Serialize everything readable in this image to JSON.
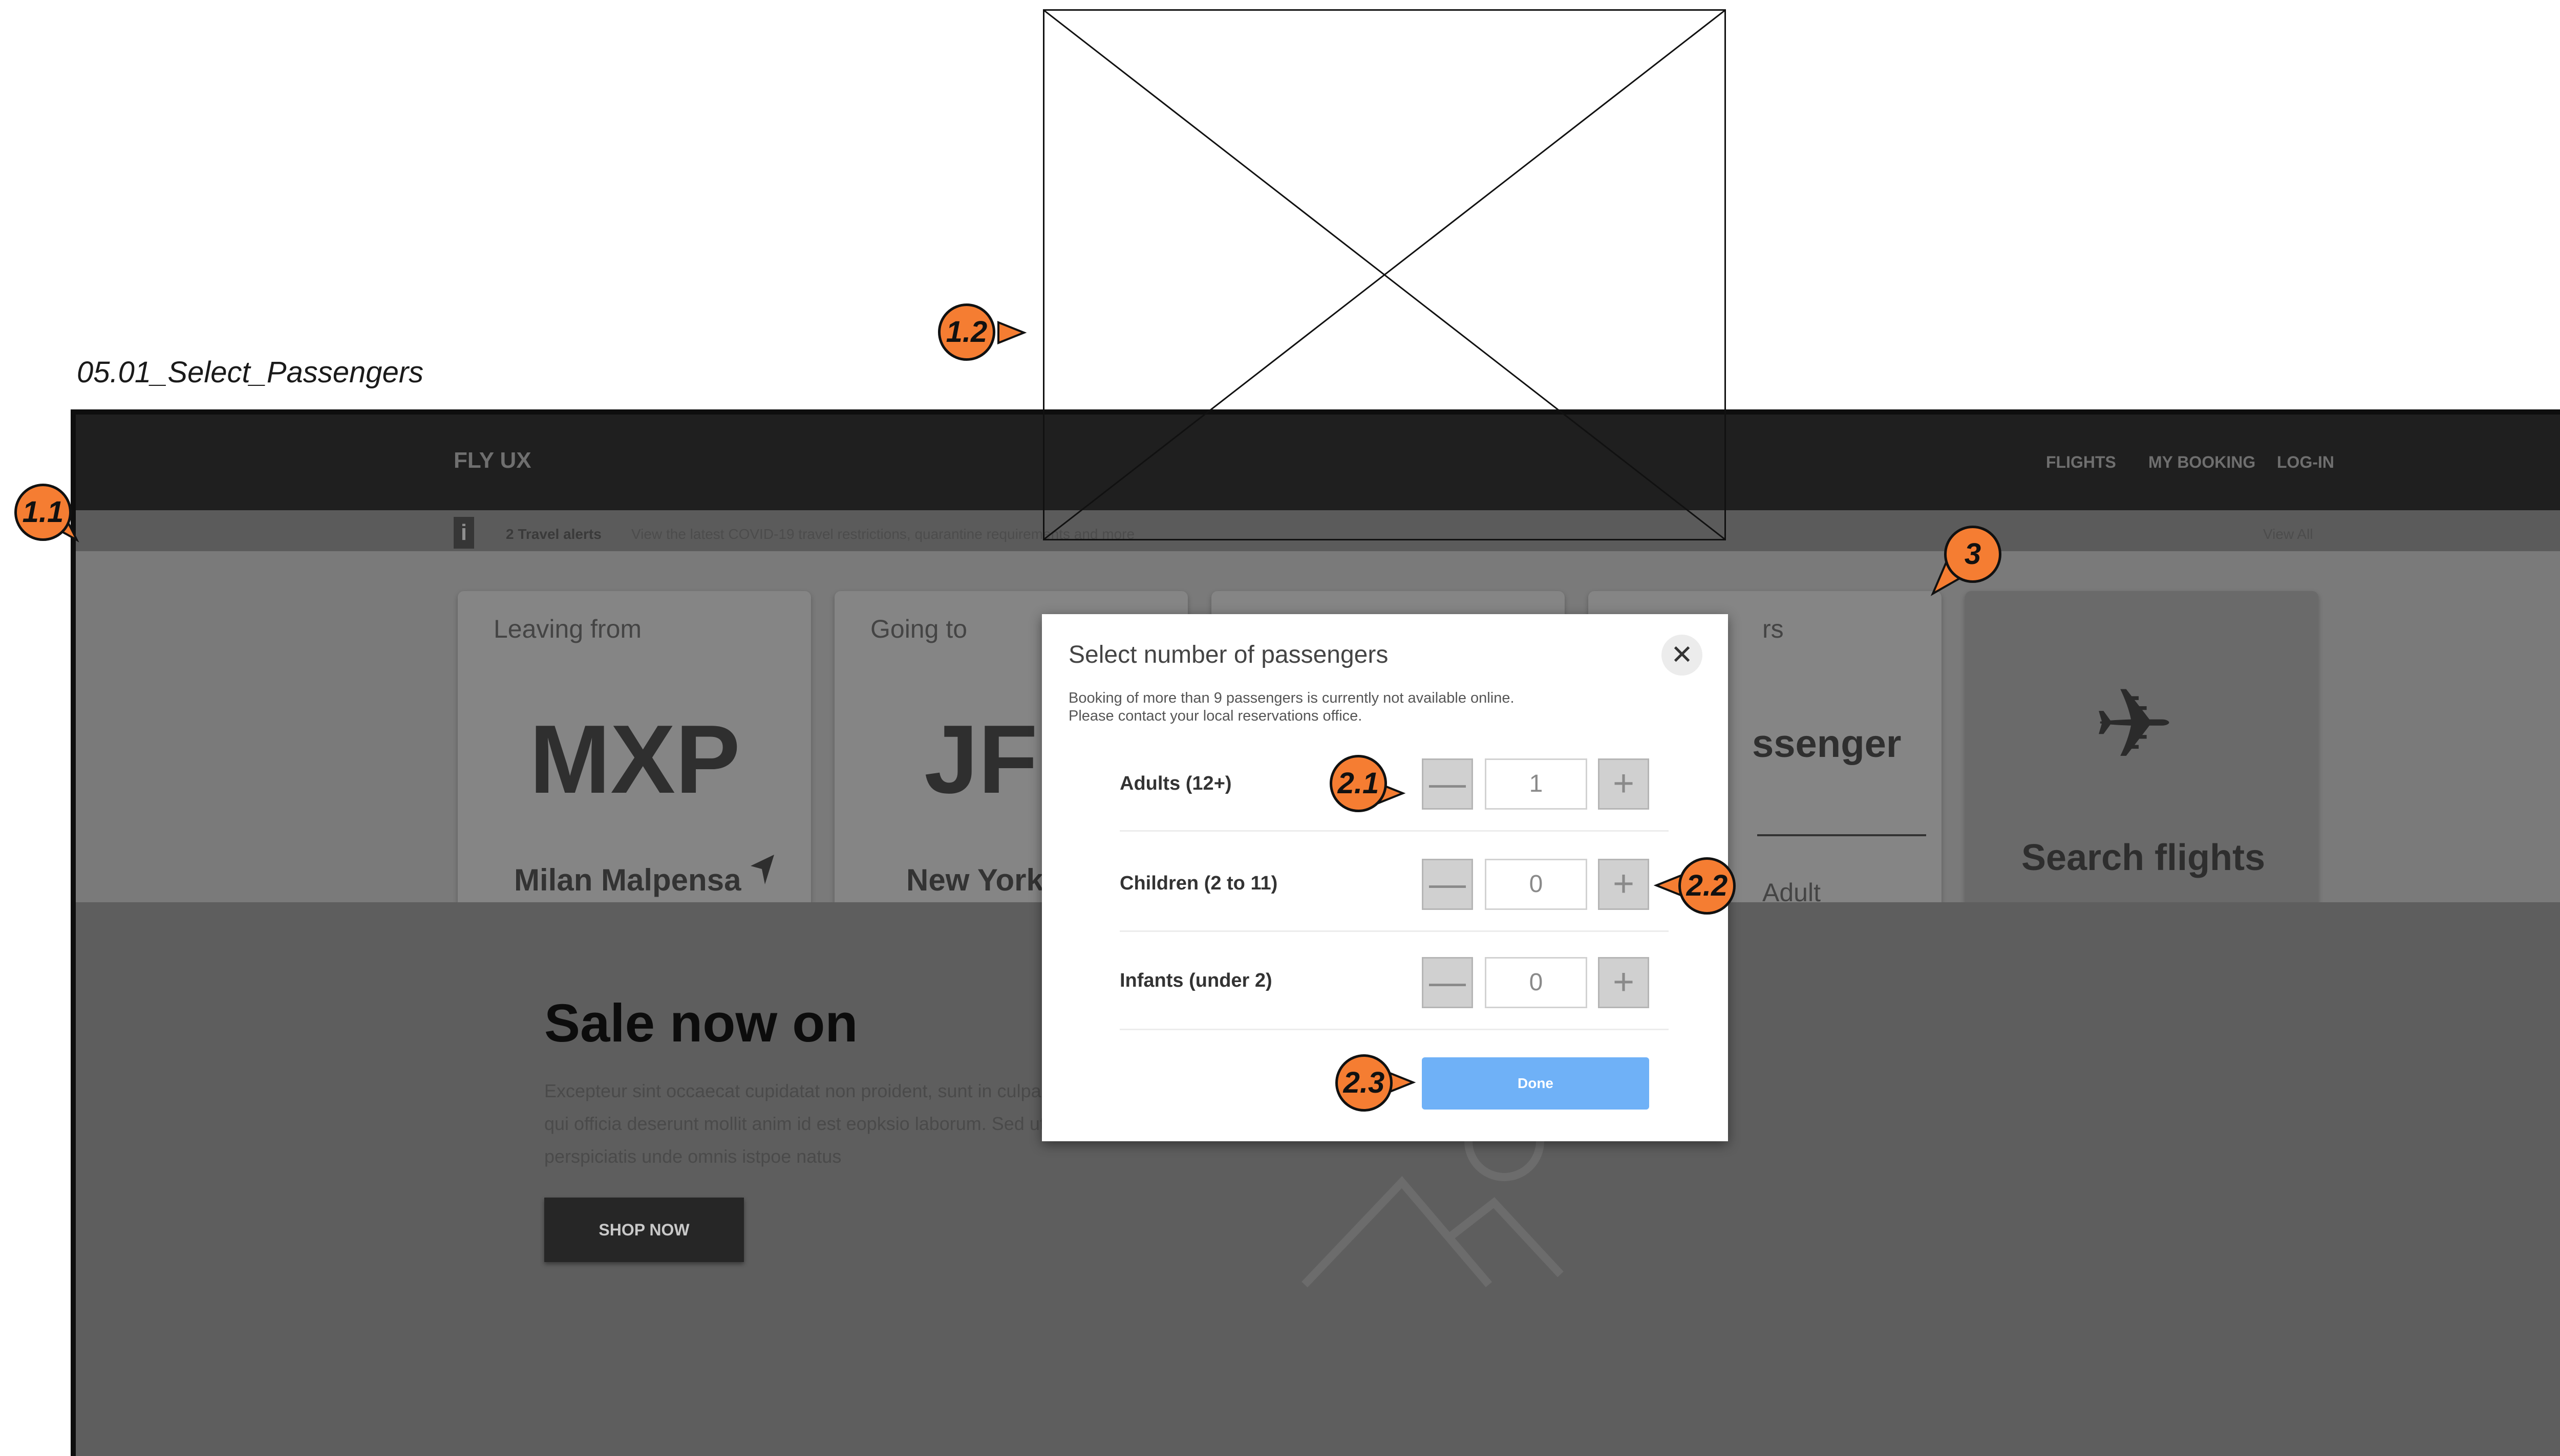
{
  "frame_label": "05.01_Select_Passengers",
  "header": {
    "brand": "FLY UX",
    "nav": [
      "FLIGHTS",
      "MY BOOKING",
      "LOG-IN"
    ]
  },
  "alert": {
    "icon": "i",
    "count": "2 Travel alerts",
    "text": "View the latest COVID-19 travel restrictions, quarantine requirements and more",
    "view_all": "View All"
  },
  "search": {
    "from": {
      "label": "Leaving from",
      "code": "MXP",
      "city": "Milan Malpensa"
    },
    "to": {
      "label": "Going to",
      "code": "JFK",
      "city": "New York"
    },
    "passengers": {
      "label_fragment": "rs",
      "value_fragment": "ssenger",
      "sub_fragment": "Adult"
    },
    "button_label": "Search flights"
  },
  "promo": {
    "title": "Sale now on",
    "text": "Excepteur sint occaecat cupidatat non proident, sunt in culpa qui officia deserunt mollit anim id est eopksio laborum. Sed ut perspiciatis unde omnis istpoe natus",
    "button": "SHOP NOW"
  },
  "modal": {
    "title": "Select number of passengers",
    "note_line1": "Booking of more than 9 passengers is currently not available online.",
    "note_line2": "Please contact your local reservations office.",
    "rows": [
      {
        "label": "Adults (12+)",
        "value": "1"
      },
      {
        "label": "Children (2 to 11)",
        "value": "0"
      },
      {
        "label": "Infants (under 2)",
        "value": "0"
      }
    ],
    "done": "Done",
    "minus": "—",
    "plus": "+",
    "close": "✕"
  },
  "annotations": {
    "b11": "1.1",
    "b12": "1.2",
    "b21": "2.1",
    "b22": "2.2",
    "b23": "2.3",
    "b3": "3"
  },
  "colors": {
    "annotation": "#f57d32",
    "done_button": "#6fb1f7",
    "alert_outline": "#c23a3a"
  }
}
